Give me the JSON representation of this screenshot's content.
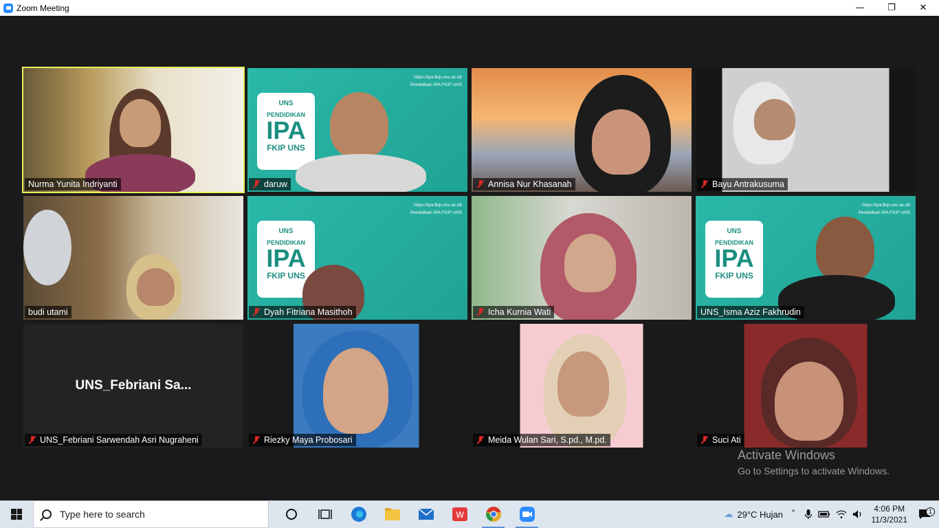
{
  "window": {
    "title": "Zoom Meeting",
    "minimize": "—",
    "restore": "❐",
    "close": "✕"
  },
  "participants": [
    {
      "name": "Nurma Yunita Indriyanti",
      "muted": false,
      "active": true,
      "video": "room"
    },
    {
      "name": "daruw",
      "muted": true,
      "video": "teal"
    },
    {
      "name": "Annisa Nur Khasanah",
      "muted": true,
      "video": "bridge"
    },
    {
      "name": "Bayu Antrakusuma",
      "muted": true,
      "video": "gray"
    },
    {
      "name": "budi utami",
      "muted": false,
      "video": "fan"
    },
    {
      "name": "Dyah Fitriana Masithoh",
      "muted": true,
      "video": "teal"
    },
    {
      "name": "Icha Kurnia Wati",
      "muted": true,
      "video": "green"
    },
    {
      "name": "UNS_Isma Aziz Fakhrudin",
      "muted": false,
      "video": "teal"
    },
    {
      "name": "UNS_Febriani Sarwendah Asri Nugraheni",
      "muted": true,
      "video": "none",
      "short_name": "UNS_Febriani  Sa..."
    },
    {
      "name": "Riezky Maya Probosari",
      "muted": true,
      "video": "blue"
    },
    {
      "name": "Meida Wulan Sari, S.pd., M.pd.",
      "muted": true,
      "video": "pink"
    },
    {
      "name": "Suci Ati",
      "muted": true,
      "video": "red"
    }
  ],
  "background_card": {
    "logo": "UNS",
    "line1": "PENDIDIKAN",
    "line2": "IPA",
    "line3": "FKIP UNS",
    "url": "https://ipa.fkip.uns.ac.id/",
    "channel": "Pendidikan IPA FKIP UNS"
  },
  "watermark": {
    "line1": "Activate Windows",
    "line2": "Go to Settings to activate Windows."
  },
  "taskbar": {
    "search_placeholder": "Type here to search",
    "weather": "29°C  Hujan",
    "time": "4:06 PM",
    "date": "11/3/2021",
    "notification_count": "1"
  }
}
